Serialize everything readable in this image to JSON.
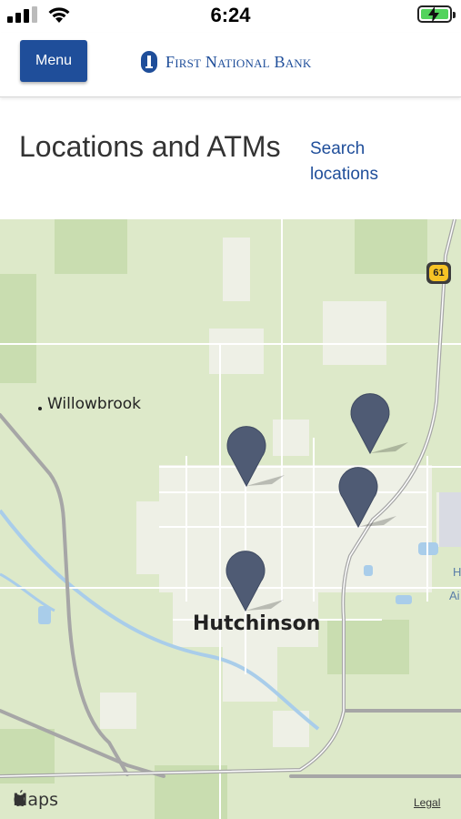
{
  "status_bar": {
    "time": "6:24"
  },
  "header": {
    "menu_label": "Menu",
    "bank_name": "First National Bank"
  },
  "page": {
    "title": "Locations and ATMs",
    "search_link": "Search locations"
  },
  "map": {
    "places": {
      "willowbrook": "Willowbrook",
      "hutchinson": "Hutchinson"
    },
    "highway_shield": "61",
    "edge_labels": [
      "H",
      "Ai"
    ],
    "provider": "Maps",
    "legal_link": "Legal"
  },
  "colors": {
    "brand_blue": "#1f4e9a",
    "pin": "#4f5b74",
    "battery_green": "#52d35c"
  }
}
